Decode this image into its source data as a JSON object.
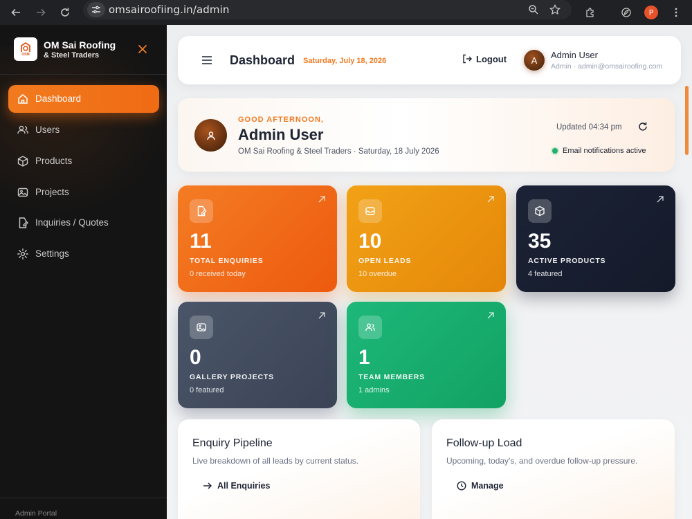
{
  "browser": {
    "url": "omsairoofiing.in/admin",
    "profile_initial": "P"
  },
  "sidebar": {
    "brand_name": "OM Sai Roofing",
    "brand_sub": "& Steel Traders",
    "logo_text": "OSM",
    "items": [
      {
        "label": "Dashboard",
        "icon": "home-icon",
        "active": true
      },
      {
        "label": "Users",
        "icon": "users-icon"
      },
      {
        "label": "Products",
        "icon": "box-icon"
      },
      {
        "label": "Projects",
        "icon": "image-icon"
      },
      {
        "label": "Inquiries / Quotes",
        "icon": "file-edit-icon"
      },
      {
        "label": "Settings",
        "icon": "gear-icon"
      }
    ],
    "footer": "Admin Portal"
  },
  "header": {
    "title": "Dashboard",
    "date": "Saturday, July 18, 2026",
    "logout_label": "Logout",
    "user_initial": "A",
    "user_name": "Admin User",
    "user_meta": "Admin · admin@omsairoofing.com"
  },
  "welcome": {
    "greeting": "GOOD AFTERNOON,",
    "name": "Admin User",
    "subtitle": "OM Sai Roofing & Steel Traders  · Saturday, 18 July 2026",
    "updated": "Updated 04:34 pm",
    "notification": "Email notifications active"
  },
  "stats": [
    {
      "value": "11",
      "label": "TOTAL ENQUIRIES",
      "sub": "0 received today",
      "color": "#f47c24"
    },
    {
      "value": "10",
      "label": "OPEN LEADS",
      "sub": "10 overdue",
      "color": "#f2a216"
    },
    {
      "value": "35",
      "label": "ACTIVE PRODUCTS",
      "sub": "4 featured",
      "color": "#1c2336"
    },
    {
      "value": "0",
      "label": "GALLERY PROJECTS",
      "sub": "0 featured",
      "color": "#4a5568"
    },
    {
      "value": "1",
      "label": "TEAM MEMBERS",
      "sub": "1 admins",
      "color": "#1db87a"
    }
  ],
  "panels": [
    {
      "title": "Enquiry Pipeline",
      "desc": "Live breakdown of all leads by current status.",
      "action": "All Enquiries"
    },
    {
      "title": "Follow-up Load",
      "desc": "Upcoming, today's, and overdue follow-up pressure.",
      "action": "Manage"
    }
  ],
  "colors": {
    "accent": "#f07a20",
    "sidebar_bg": "#141414",
    "text_dark": "#1d2433"
  }
}
